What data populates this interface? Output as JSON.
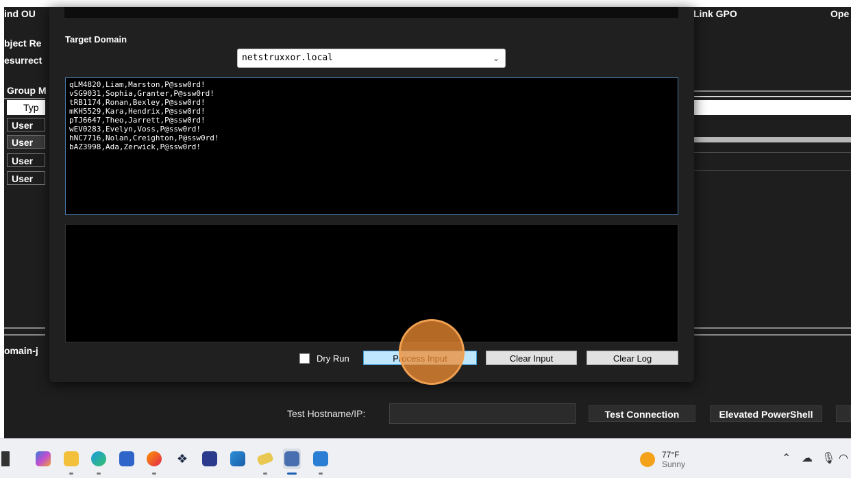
{
  "background": {
    "find_ou": "ind OU",
    "object_re": "bject Re",
    "resurrect": "esurrect",
    "group": "Group M",
    "type_header": "Typ",
    "type_rows": [
      "User",
      "User",
      "User",
      "User"
    ],
    "domain_j": "omain-j",
    "link_gpo": "Link GPO",
    "ope": "Ope"
  },
  "modal": {
    "target_domain_label": "Target Domain",
    "domain_select": {
      "value": "netstruxxor.local"
    },
    "input_lines": [
      "qLM4820,Liam,Marston,P@ssw0rd!",
      "vSG9031,Sophia,Granter,P@ssw0rd!",
      "tRB1174,Ronan,Bexley,P@ssw0rd!",
      "mKH5529,Kara,Hendrix,P@ssw0rd!",
      "pTJ6647,Theo,Jarrett,P@ssw0rd!",
      "wEV0283,Evelyn,Voss,P@ssw0rd!",
      "hNC7716,Nolan,Creighton,P@ssw0rd!",
      "bAZ3998,Ada,Zerwick,P@ssw0rd!"
    ],
    "dry_run_label": "Dry Run",
    "process_input": "Process Input",
    "clear_input": "Clear Input",
    "clear_log": "Clear Log"
  },
  "bottom": {
    "test_hostname_label": "Test Hostname/IP:",
    "test_connection": "Test Connection",
    "elevated_powershell": "Elevated PowerShell"
  },
  "taskbar": {
    "icons": [
      "start-icon",
      "m365-icon",
      "file-explorer-icon",
      "edge-icon",
      "store-icon",
      "firefox-icon",
      "dropbox-icon",
      "app-icon",
      "remote-desktop-icon",
      "notes-icon",
      "active-app-icon",
      "notepad-icon"
    ],
    "weather_temp": "77°F",
    "weather_desc": "Sunny"
  }
}
